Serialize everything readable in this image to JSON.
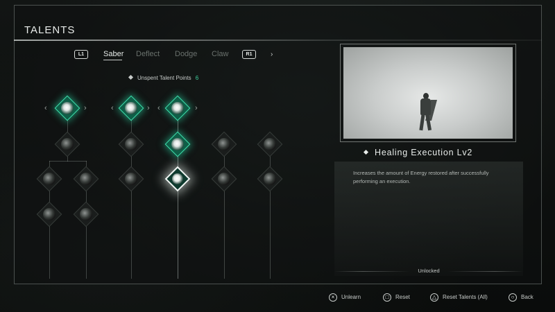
{
  "header": {
    "title": "TALENTS"
  },
  "tabs": {
    "left_shoulder": "L1",
    "right_shoulder": "R1",
    "items": [
      "Saber",
      "Deflect",
      "Dodge",
      "Claw"
    ],
    "active": "Saber",
    "next_arrow": "›"
  },
  "points": {
    "label": "Unspent Talent Points",
    "value": "6"
  },
  "tree": {
    "nav_left": "‹",
    "nav_right": "›",
    "selected_node": "Healing Execution Lv2",
    "state_colors": {
      "unlocked": "#3fe0ad",
      "selected": "#f2f5f3",
      "locked": "#1a1d1c"
    }
  },
  "detail": {
    "name": "Healing Execution Lv2",
    "description": "Increases the amount of Energy restored after successfully performing an execution.",
    "status": "Unlocked"
  },
  "footer": {
    "buttons": [
      {
        "icon": "×",
        "label": "Unlearn"
      },
      {
        "icon": "□",
        "label": "Reset"
      },
      {
        "icon": "△",
        "label": "Reset Talents (All)"
      },
      {
        "icon": "○",
        "label": "Back"
      }
    ]
  }
}
